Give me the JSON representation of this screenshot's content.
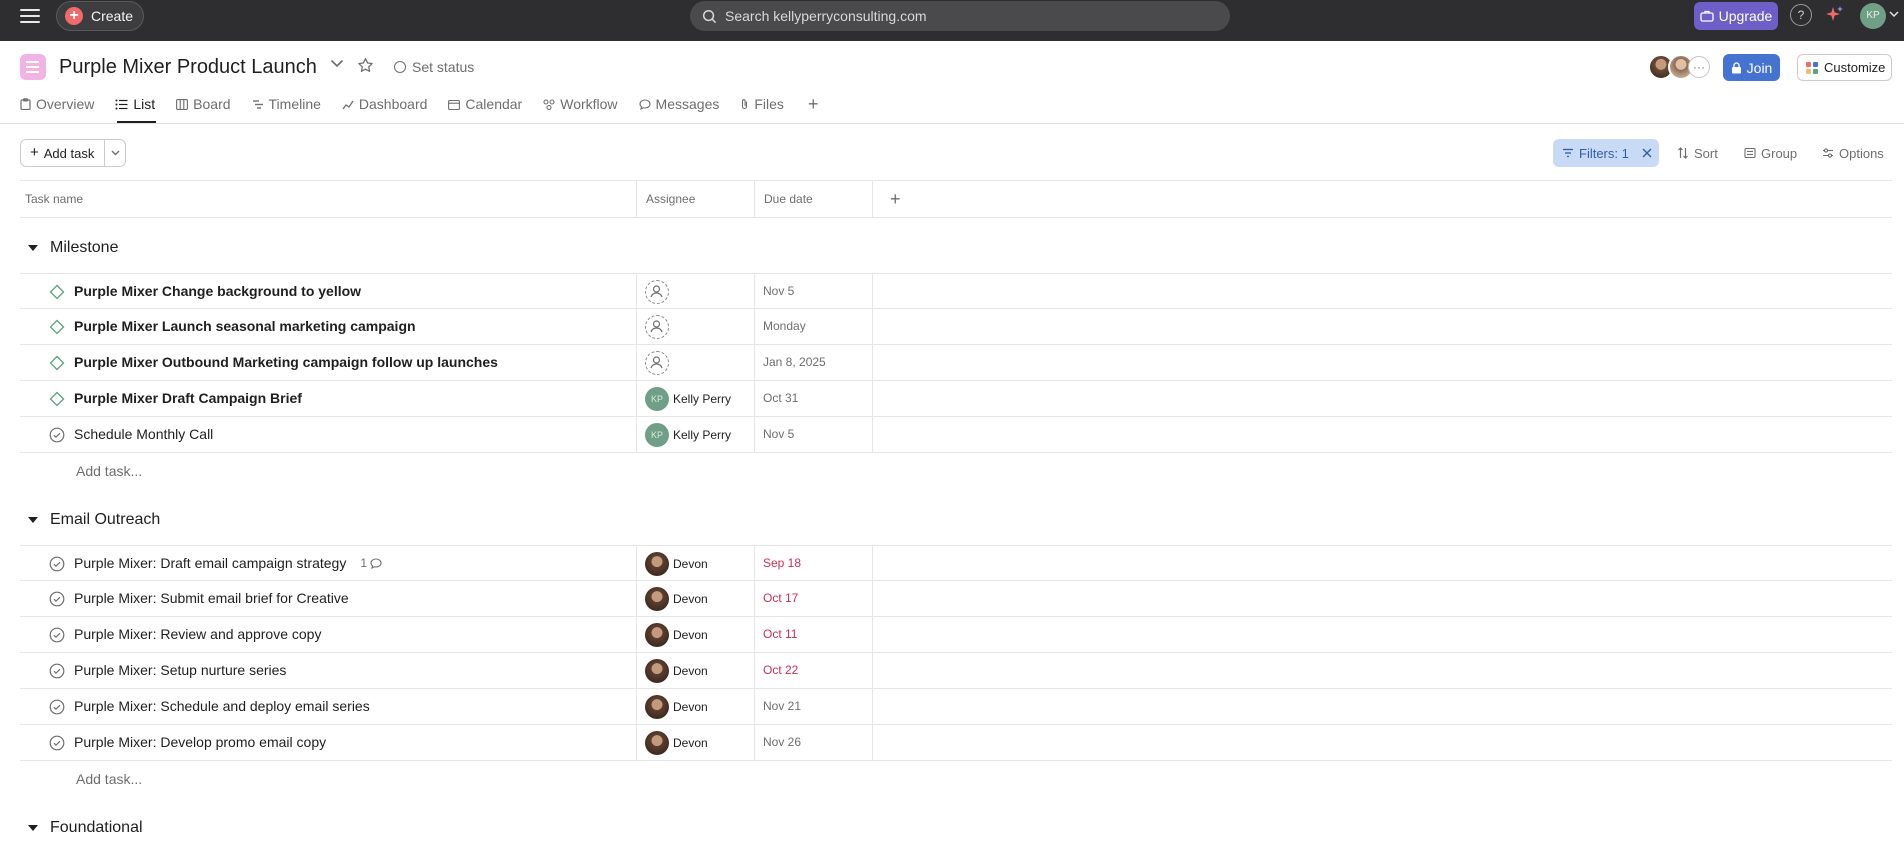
{
  "topbar": {
    "create_label": "Create",
    "search_placeholder": "Search kellyperryconsulting.com",
    "upgrade_label": "Upgrade",
    "help_label": "?",
    "user_initials": "KP"
  },
  "project": {
    "title": "Purple Mixer Product Launch",
    "set_status_label": "Set status",
    "join_label": "Join",
    "customize_label": "Customize",
    "members_more": "···"
  },
  "tabs": [
    {
      "label": "Overview"
    },
    {
      "label": "List",
      "active": true
    },
    {
      "label": "Board"
    },
    {
      "label": "Timeline"
    },
    {
      "label": "Dashboard"
    },
    {
      "label": "Calendar"
    },
    {
      "label": "Workflow"
    },
    {
      "label": "Messages"
    },
    {
      "label": "Files"
    }
  ],
  "toolbar": {
    "add_task_label": "Add task",
    "filters_label": "Filters: 1",
    "sort_label": "Sort",
    "group_label": "Group",
    "options_label": "Options"
  },
  "columns": {
    "task_name": "Task name",
    "assignee": "Assignee",
    "due_date": "Due date",
    "add": "+"
  },
  "sections": [
    {
      "name": "Milestone",
      "add_task_label": "Add task...",
      "tasks": [
        {
          "name": "Purple Mixer Change background to yellow",
          "type": "milestone",
          "assignee": "",
          "due": "Nov 5",
          "overdue": false
        },
        {
          "name": "Purple Mixer Launch seasonal marketing campaign",
          "type": "milestone",
          "assignee": "",
          "due": "Monday",
          "overdue": false
        },
        {
          "name": "Purple Mixer Outbound Marketing campaign follow up launches",
          "type": "milestone",
          "assignee": "",
          "due": "Jan 8, 2025",
          "overdue": false
        },
        {
          "name": "Purple Mixer Draft Campaign Brief",
          "type": "milestone",
          "assignee": "Kelly Perry",
          "due": "Oct 31",
          "overdue": false
        },
        {
          "name": "Schedule Monthly Call",
          "type": "task",
          "assignee": "Kelly Perry",
          "due": "Nov 5",
          "overdue": false
        }
      ]
    },
    {
      "name": "Email Outreach",
      "add_task_label": "Add task...",
      "tasks": [
        {
          "name": "Purple Mixer: Draft email campaign strategy",
          "type": "task",
          "comments": "1",
          "assignee": "Devon",
          "due": "Sep 18",
          "overdue": true
        },
        {
          "name": "Purple Mixer: Submit email brief for Creative",
          "type": "task",
          "assignee": "Devon",
          "due": "Oct 17",
          "overdue": true
        },
        {
          "name": "Purple Mixer: Review and approve copy",
          "type": "task",
          "assignee": "Devon",
          "due": "Oct 11",
          "overdue": true
        },
        {
          "name": "Purple Mixer: Setup nurture series",
          "type": "task",
          "assignee": "Devon",
          "due": "Oct 22",
          "overdue": true
        },
        {
          "name": "Purple Mixer: Schedule and deploy email series",
          "type": "task",
          "assignee": "Devon",
          "due": "Nov 21",
          "overdue": false
        },
        {
          "name": "Purple Mixer: Develop promo email copy",
          "type": "task",
          "assignee": "Devon",
          "due": "Nov 26",
          "overdue": false
        }
      ]
    },
    {
      "name": "Foundational"
    }
  ],
  "colors": {
    "topbar_bg": "#2e2e30",
    "upgrade": "#6c5fc7",
    "join": "#4573d2",
    "filter_bg": "#c9daf7",
    "overdue": "#c92f54",
    "project_icon": "#f1b3e4"
  }
}
